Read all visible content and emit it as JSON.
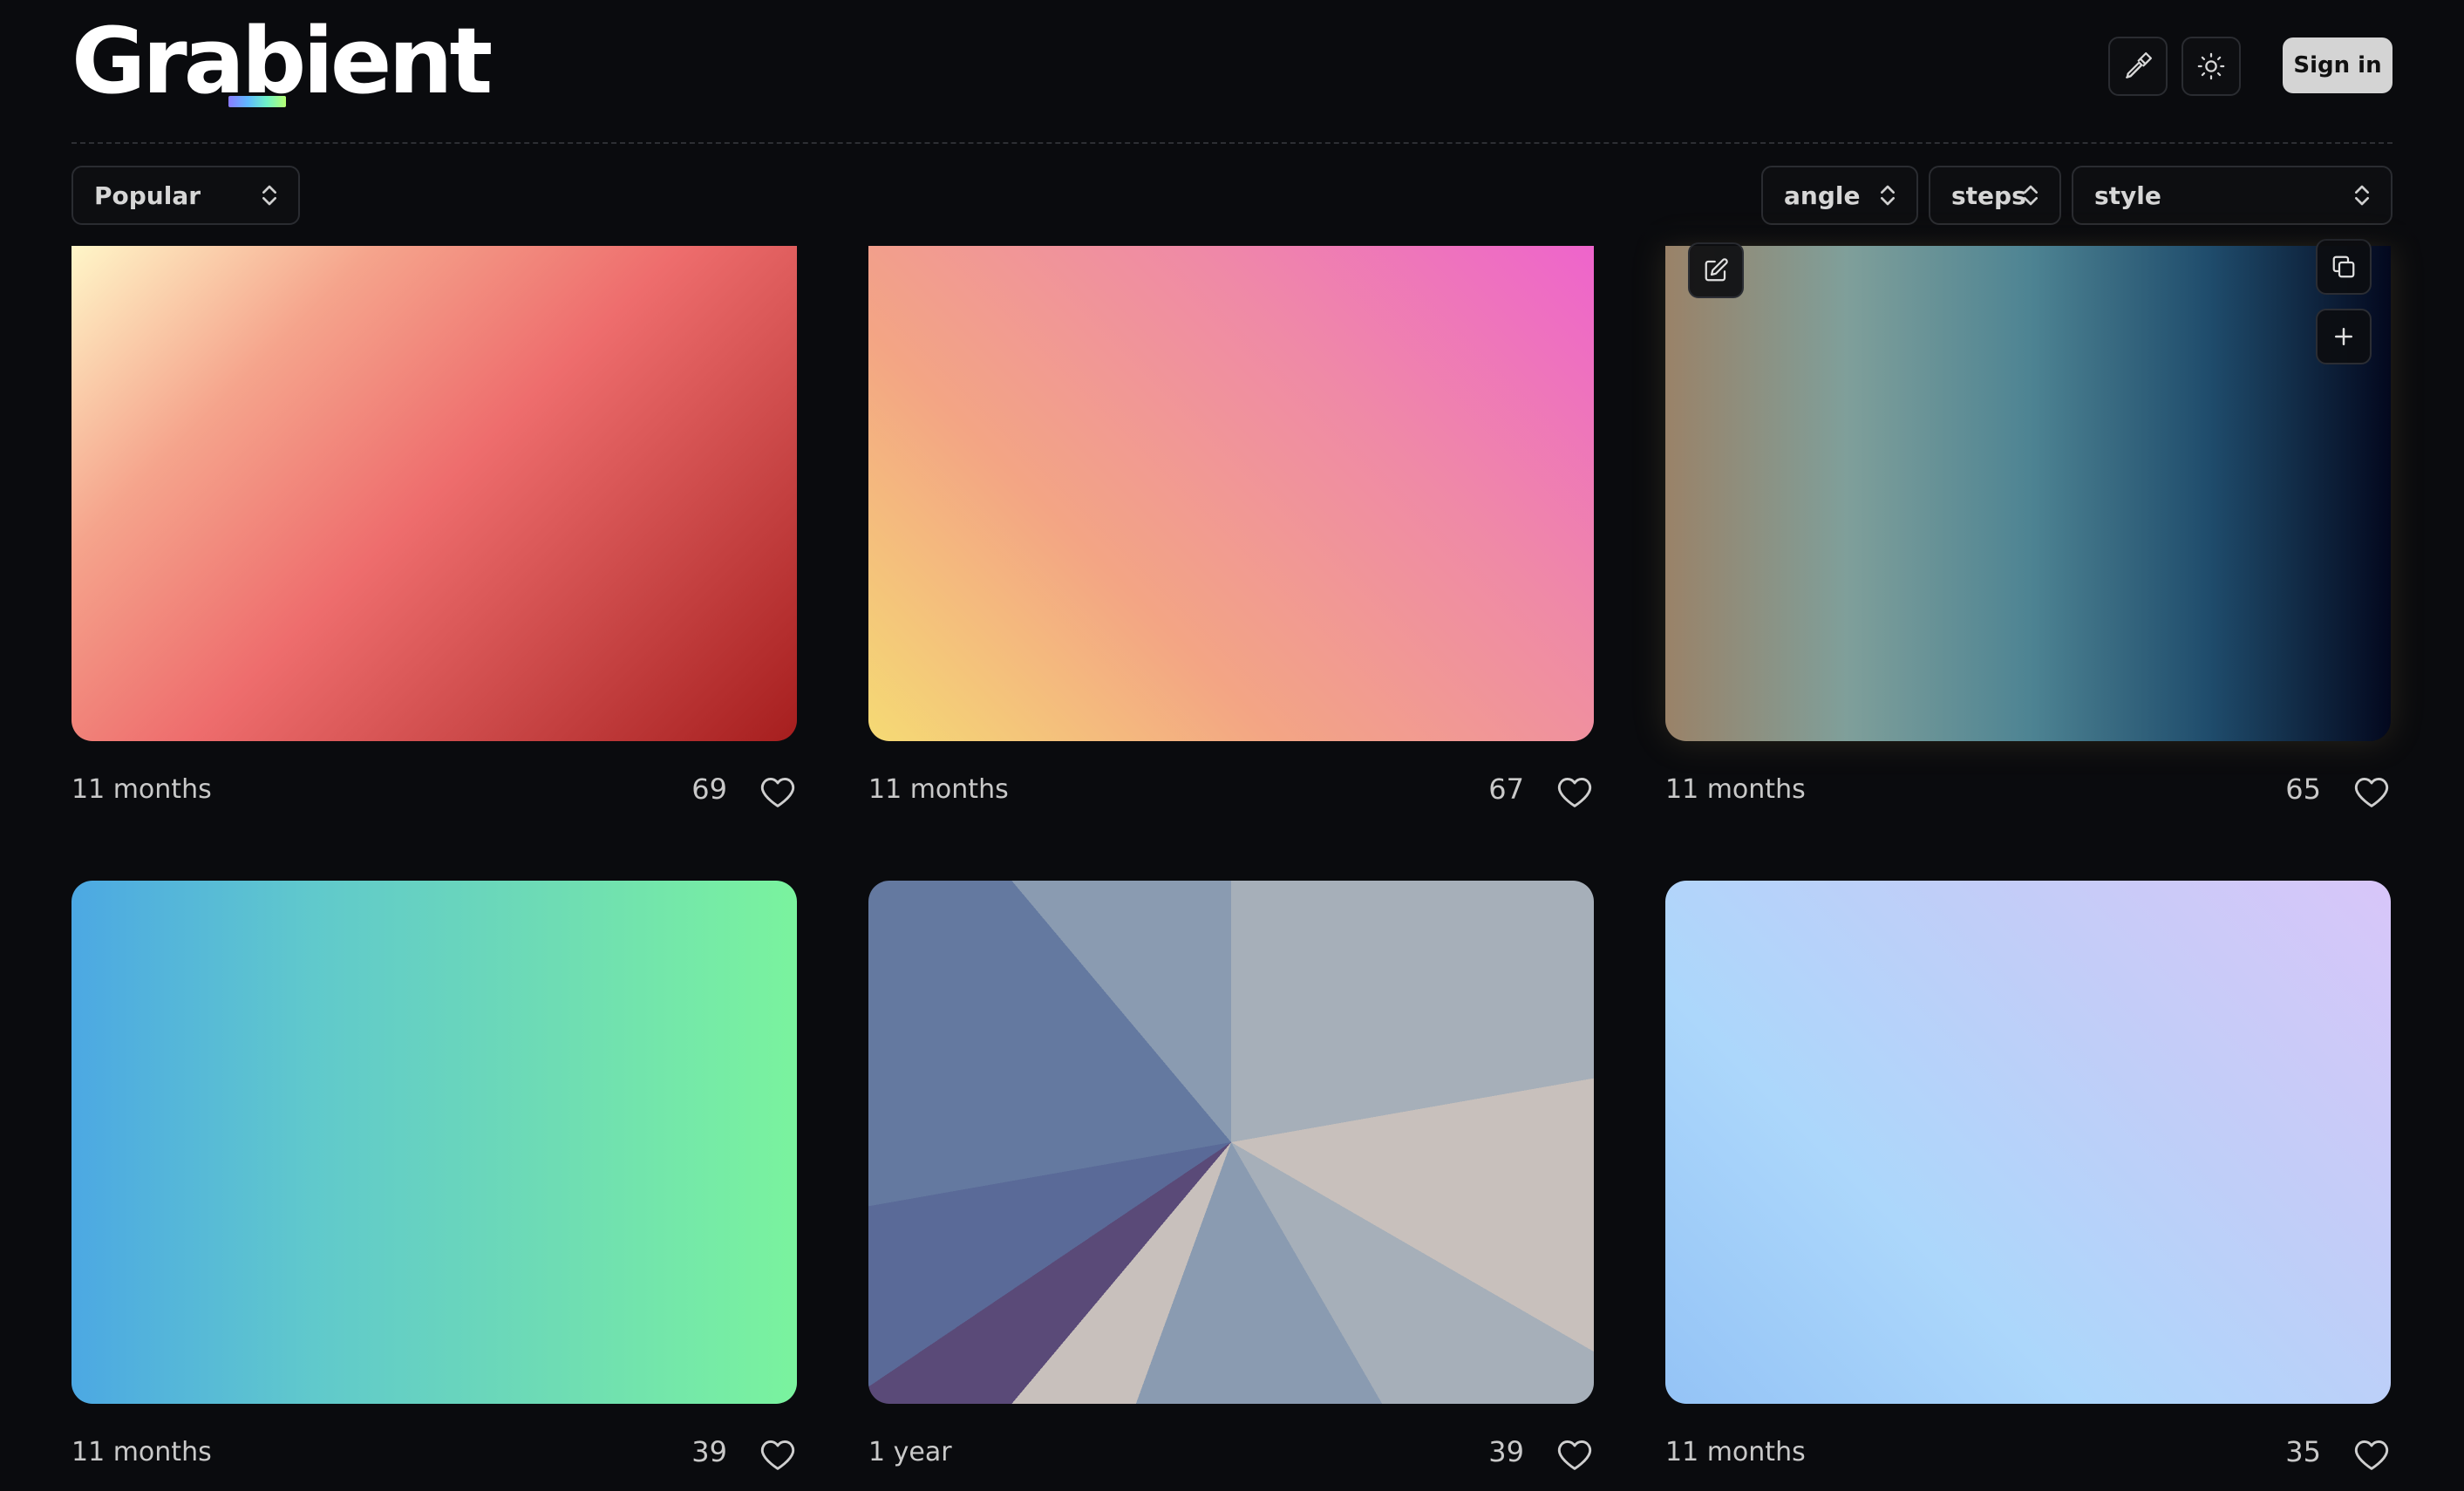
{
  "header": {
    "logo": "Grabient",
    "sign_in_label": "Sign in",
    "eyedropper_icon": "eyedropper-icon",
    "theme_icon": "sun-icon"
  },
  "filters": {
    "sort": "Popular",
    "angle": "angle",
    "steps": "steps",
    "style": "style"
  },
  "cards": [
    {
      "time": "11 months",
      "likes": "69",
      "colors": [
        "#fff6c8",
        "#f5a48c",
        "#ee6d6d",
        "#c94646",
        "#a61e1e"
      ]
    },
    {
      "time": "11 months",
      "likes": "67",
      "colors": [
        "#f5da74",
        "#f3a584",
        "#ef8aa6",
        "#ee64cc"
      ]
    },
    {
      "time": "11 months",
      "likes": "65",
      "colors": [
        "#9a8268",
        "#7f9f9a",
        "#4e8493",
        "#1f4c6c",
        "#03081e"
      ]
    },
    {
      "time": "11 months",
      "likes": "39",
      "colors": [
        "#4ca8e3",
        "#60c9cc",
        "#6edcb4",
        "#7af39e"
      ]
    },
    {
      "time": "1 year",
      "likes": "39",
      "colors": [
        "#c8c0bc",
        "#a6afb9",
        "#8a9bb1",
        "#6479a0",
        "#5a6a98",
        "#5a4a78"
      ]
    },
    {
      "time": "11 months",
      "likes": "35",
      "colors": [
        "#94c3f6",
        "#acd7fb",
        "#c2cdf8",
        "#d8c6f9"
      ]
    }
  ]
}
